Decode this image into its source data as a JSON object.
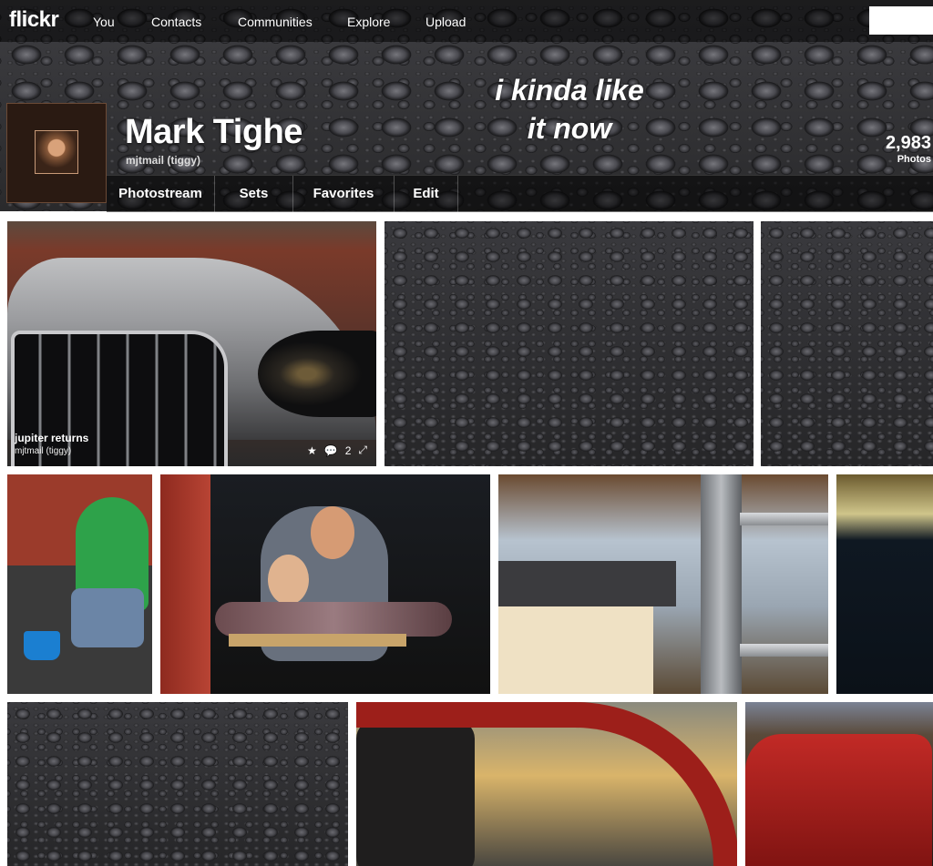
{
  "topbar": {
    "logo": "flickr",
    "nav": [
      "You",
      "Contacts",
      "Communities",
      "Explore",
      "Upload"
    ]
  },
  "cover": {
    "overlay_text_line1": "i kinda like",
    "overlay_text_line2": "it now"
  },
  "profile": {
    "name": "Mark Tighe",
    "handle": "mjtmail (tiggy)",
    "photos_count": "2,983",
    "photos_label": "Photos"
  },
  "subnav": [
    "Photostream",
    "Sets",
    "Favorites",
    "Edit"
  ],
  "photos": [
    {
      "title": "jupiter returns",
      "owner": "mjtmail (tiggy)",
      "comments": "2"
    }
  ],
  "icons": {
    "favorite": "star-icon",
    "comment": "comment-icon",
    "expand": "expand-icon"
  }
}
